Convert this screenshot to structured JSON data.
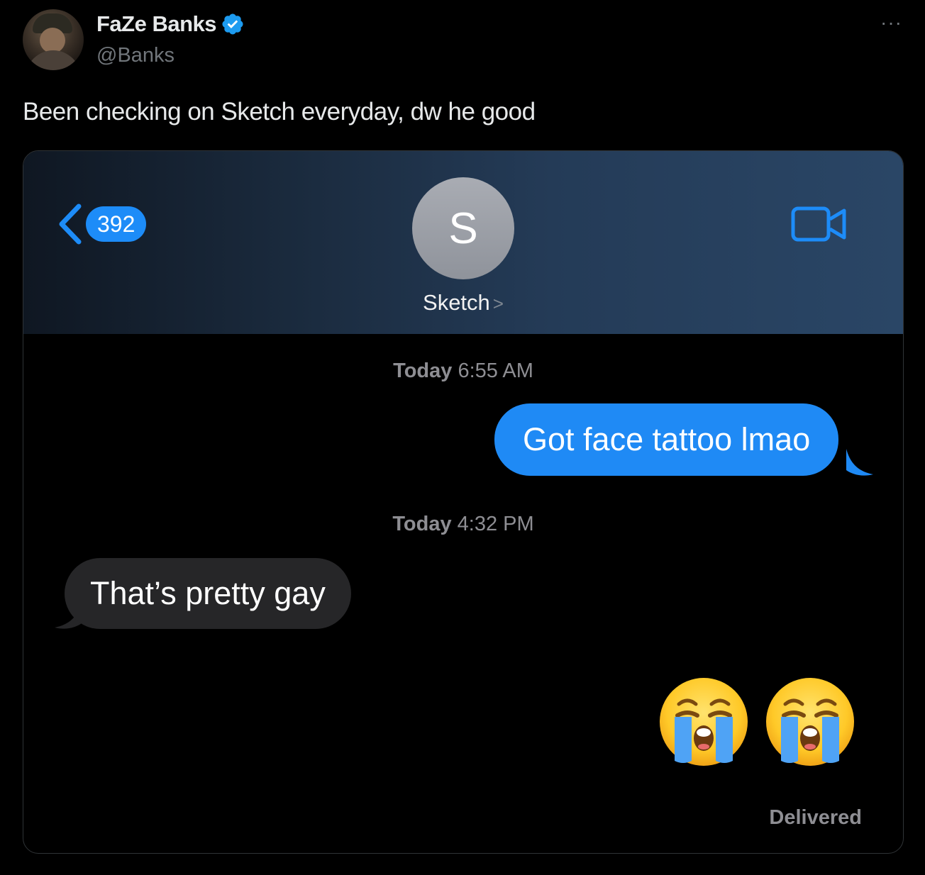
{
  "tweet": {
    "display_name": "FaZe Banks",
    "handle": "@Banks",
    "text": "Been checking on Sketch everyday, dw he good",
    "more_icon": "more-icon",
    "verified_icon": "verified-badge-icon"
  },
  "messages_screenshot": {
    "back_count": "392",
    "contact_initial": "S",
    "contact_name": "Sketch",
    "contact_chevron": ">",
    "timestamps": [
      {
        "day": "Today",
        "time": "6:55 AM"
      },
      {
        "day": "Today",
        "time": "4:32 PM"
      }
    ],
    "sent_message": "Got face tattoo lmao",
    "received_message": "That’s pretty gay",
    "emoji": [
      "loudly-crying-face-emoji",
      "loudly-crying-face-emoji"
    ],
    "status": "Delivered"
  },
  "colors": {
    "imessage_blue": "#1f8af5",
    "received_bubble": "#262628",
    "twitter_verified": "#1d9bf0"
  }
}
